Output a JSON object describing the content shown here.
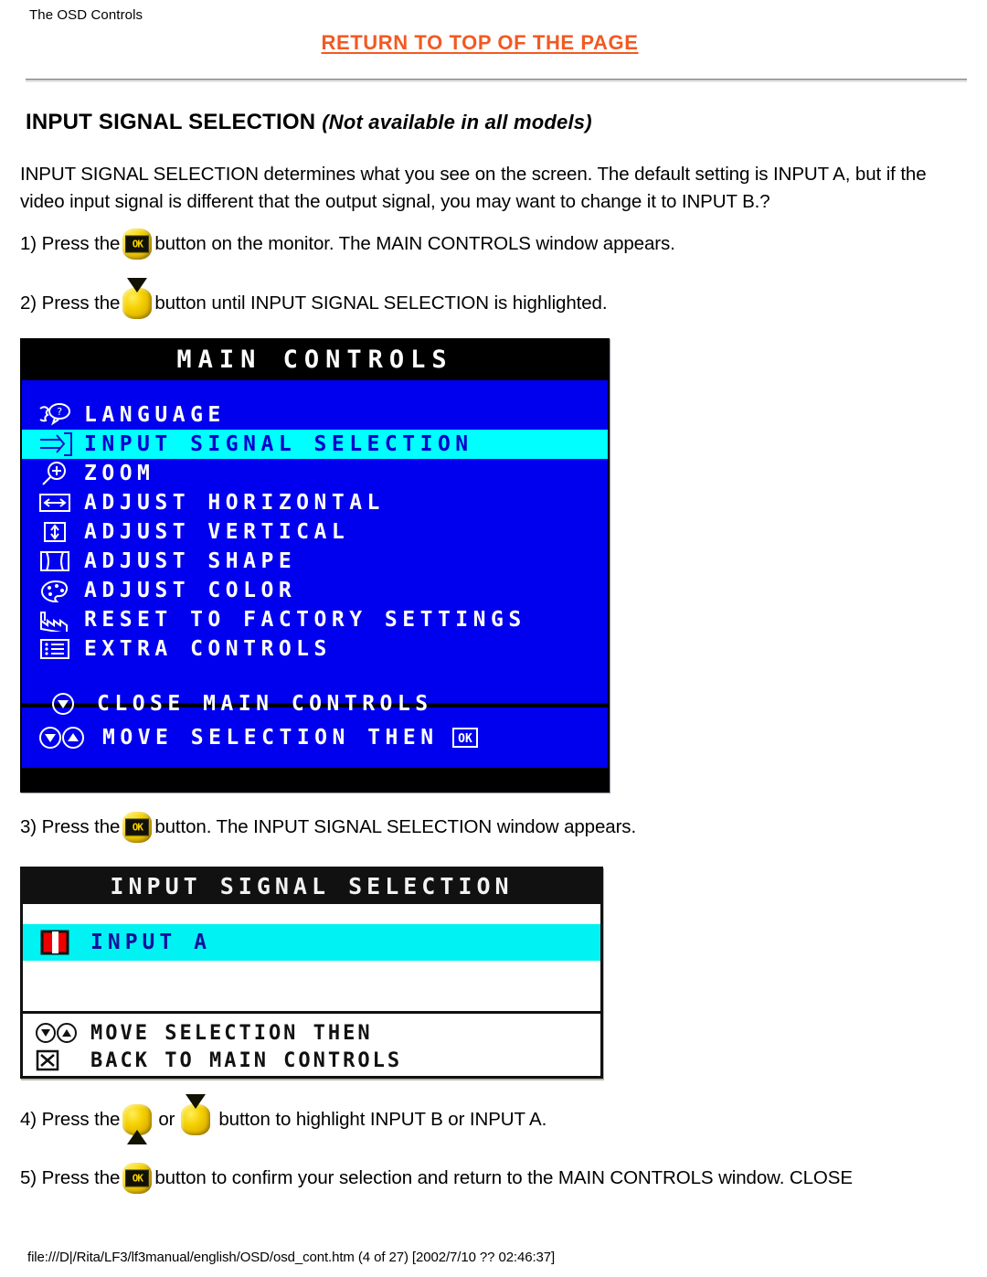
{
  "header": {
    "breadcrumb": "The OSD Controls",
    "return_link": "RETURN TO TOP OF THE PAGE"
  },
  "section": {
    "title": "INPUT SIGNAL SELECTION",
    "note": "(Not available in all models)"
  },
  "intro": "INPUT SIGNAL SELECTION determines what you see on the screen. The default setting is INPUT A, but if the video input signal is different that the output signal, you may want to change it to INPUT B.?",
  "steps": {
    "s1_a": "1) Press the",
    "s1_b": "button on the monitor. The MAIN CONTROLS window appears.",
    "s2_a": "2) Press the",
    "s2_b": "button until INPUT SIGNAL SELECTION is highlighted.",
    "s3_a": "3) Press the",
    "s3_b": "button. The INPUT SIGNAL SELECTION window appears.",
    "s4_a": "4) Press the",
    "s4_or": "or",
    "s4_b": "button to highlight INPUT B or INPUT A.",
    "s5_a": "5) Press the",
    "s5_b": "button to confirm your selection and return to the MAIN CONTROLS window. CLOSE"
  },
  "osd_main": {
    "title": "MAIN CONTROLS",
    "items": [
      {
        "icon": "language-icon",
        "label": "LANGUAGE",
        "selected": false
      },
      {
        "icon": "input-signal-icon",
        "label": "INPUT SIGNAL SELECTION",
        "selected": true
      },
      {
        "icon": "zoom-icon",
        "label": "ZOOM",
        "selected": false
      },
      {
        "icon": "adjust-horizontal-icon",
        "label": "ADJUST HORIZONTAL",
        "selected": false
      },
      {
        "icon": "adjust-vertical-icon",
        "label": "ADJUST VERTICAL",
        "selected": false
      },
      {
        "icon": "adjust-shape-icon",
        "label": "ADJUST SHAPE",
        "selected": false
      },
      {
        "icon": "adjust-color-icon",
        "label": "ADJUST COLOR",
        "selected": false
      },
      {
        "icon": "factory-reset-icon",
        "label": "RESET TO FACTORY SETTINGS",
        "selected": false
      },
      {
        "icon": "extra-controls-icon",
        "label": "EXTRA CONTROLS",
        "selected": false
      }
    ],
    "close_label": "CLOSE MAIN CONTROLS",
    "footer_label": "MOVE SELECTION THEN",
    "footer_ok": "OK",
    "colors": {
      "background": "#0000ee",
      "title_bar": "#000000",
      "highlight": "#00ffff",
      "highlight_text": "#0000cc",
      "text": "#ffffff"
    }
  },
  "osd_input": {
    "title": "INPUT SIGNAL SELECTION",
    "selected_item": "INPUT A",
    "footer_line1": "MOVE SELECTION THEN",
    "footer_line2": "BACK TO MAIN CONTROLS",
    "colors": {
      "background": "#ffffff",
      "title_bar": "#111111",
      "highlight": "#00f2f2",
      "highlight_text": "#11119e",
      "marker": "#ee0000"
    }
  },
  "footer": {
    "path": "file:///D|/Rita/LF3/lf3manual/english/OSD/osd_cont.htm (4 of 27) [2002/7/10 ?? 02:46:37]"
  },
  "accent_colors": {
    "link": "#f15a22",
    "button_yellow": "#f5d000"
  }
}
